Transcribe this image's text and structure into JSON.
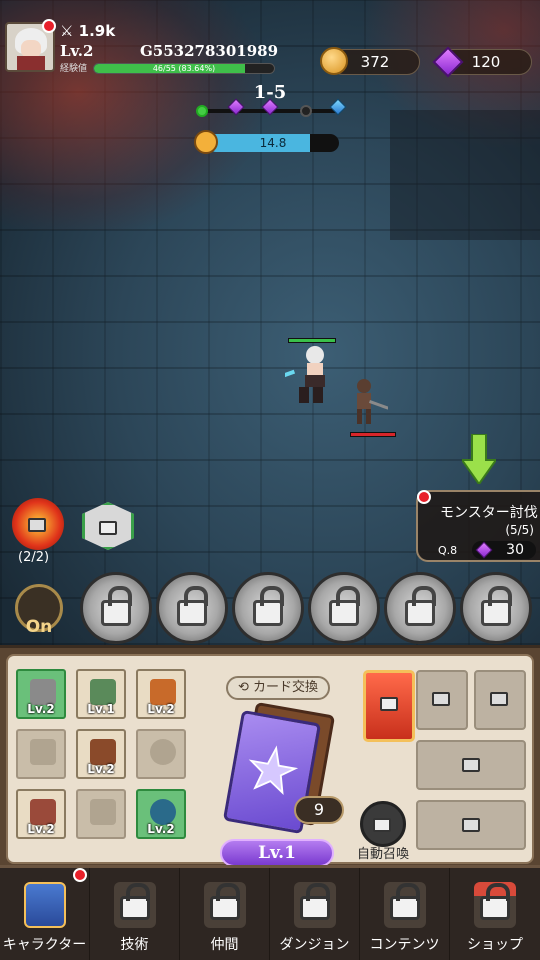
{
  "header": {
    "combat_power": "1.9k",
    "level": "Lv.2",
    "exp_label": "経験値",
    "player_id": "G553278301989",
    "exp_text": "46/55 (83.64%)",
    "exp_fraction": 0.8364
  },
  "currency": {
    "gold": "372",
    "gems": "120"
  },
  "stage": {
    "name": "1-5",
    "progress_fraction": 0.05,
    "timer": "14.8",
    "timer_fraction": 0.78
  },
  "skills": {
    "count": "(2/2)",
    "auto_label": "On"
  },
  "mission": {
    "title": "モンスター討伐",
    "count": "(5/5)",
    "quest": "Q.8",
    "reward": "30"
  },
  "panel": {
    "equipment": [
      {
        "name": "sword",
        "level": "Lv.2",
        "state": "green"
      },
      {
        "name": "armor",
        "level": "Lv.1",
        "state": "on"
      },
      {
        "name": "bracer",
        "level": "Lv.2",
        "state": "on"
      },
      {
        "name": "pants",
        "level": "",
        "state": "off"
      },
      {
        "name": "boots",
        "level": "Lv.2",
        "state": "on"
      },
      {
        "name": "fire",
        "level": "",
        "state": "off"
      },
      {
        "name": "belt",
        "level": "Lv.2",
        "state": "on"
      },
      {
        "name": "helmet",
        "level": "",
        "state": "off"
      },
      {
        "name": "shield",
        "level": "Lv.2",
        "state": "green"
      }
    ],
    "card_exchange": "カード交換",
    "card_count": "9",
    "summon_level": "Lv.1",
    "auto_summon": "自動召喚"
  },
  "nav": [
    {
      "label": "キャラクター"
    },
    {
      "label": "技術"
    },
    {
      "label": "仲間"
    },
    {
      "label": "ダンジョン"
    },
    {
      "label": "コンテンツ"
    },
    {
      "label": "ショップ"
    }
  ],
  "colors": {
    "exp_bar": "#3fbf4a",
    "timer_bar": "#4ab6e0",
    "level_button": "#7a3ad0",
    "notification": "#e8202a"
  }
}
